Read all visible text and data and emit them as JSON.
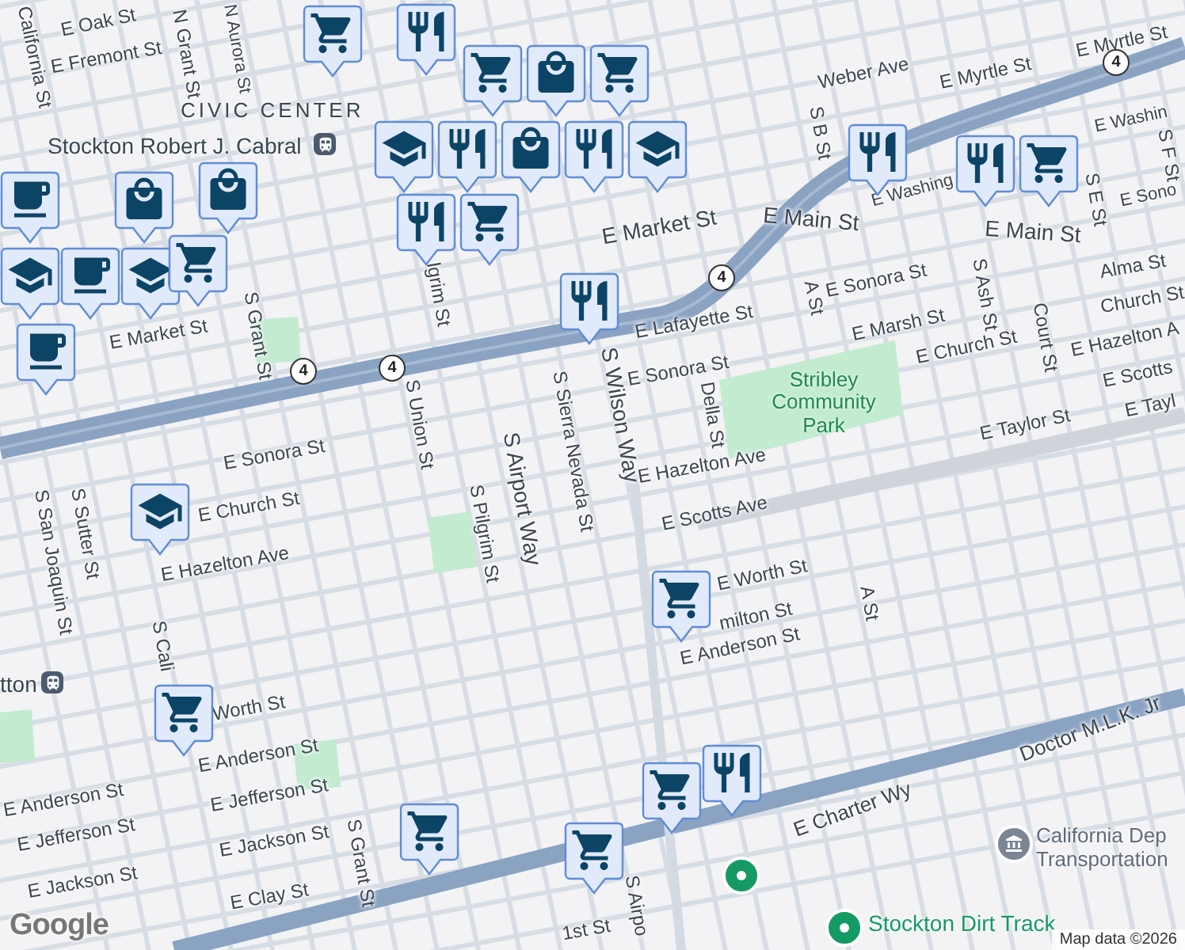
{
  "map": {
    "district_label": "CIVIC CENTER",
    "streets": [
      {
        "name": "E Oak St"
      },
      {
        "name": "E Fremont St"
      },
      {
        "name": "California St"
      },
      {
        "name": "N Grant St"
      },
      {
        "name": "N Aurora St"
      },
      {
        "name": "E Market St"
      },
      {
        "name": "S Grant St"
      },
      {
        "name": "lgrim St"
      },
      {
        "name": "S Union St"
      },
      {
        "name": "S Airport Way"
      },
      {
        "name": "S Sierra Nevada St"
      },
      {
        "name": "S Wilson Way"
      },
      {
        "name": "E Sonora St"
      },
      {
        "name": "E Market St"
      },
      {
        "name": "E Main St"
      },
      {
        "name": "E Main St"
      },
      {
        "name": "Weber Ave"
      },
      {
        "name": "E Myrtle St"
      },
      {
        "name": "E Myrtle St"
      },
      {
        "name": "S B St"
      },
      {
        "name": "E Washing"
      },
      {
        "name": "E Washin"
      },
      {
        "name": "E Lafayette St"
      },
      {
        "name": "E Sonora St"
      },
      {
        "name": "A St"
      },
      {
        "name": "E Marsh St"
      },
      {
        "name": "E Church St"
      },
      {
        "name": "S Ash St"
      },
      {
        "name": "Court St"
      },
      {
        "name": "Alma St"
      },
      {
        "name": "Church St"
      },
      {
        "name": "E Hazelton A"
      },
      {
        "name": "E Scotts"
      },
      {
        "name": "E Tayl"
      },
      {
        "name": "E Taylor St"
      },
      {
        "name": "E Sonora St"
      },
      {
        "name": "Della St"
      },
      {
        "name": "E Hazelton Ave"
      },
      {
        "name": "E Scotts Ave"
      },
      {
        "name": "E Worth St"
      },
      {
        "name": "milton St"
      },
      {
        "name": "E Anderson St"
      },
      {
        "name": "A St"
      },
      {
        "name": "E Charter Wy"
      },
      {
        "name": "Doctor M.L.K. Jr"
      },
      {
        "name": "S Sutter St"
      },
      {
        "name": "S San Joaquin St"
      },
      {
        "name": "E Church St"
      },
      {
        "name": "E Hazelton Ave"
      },
      {
        "name": "S Cali"
      },
      {
        "name": "Worth St"
      },
      {
        "name": "E Anderson St"
      },
      {
        "name": "E Anderson St"
      },
      {
        "name": "E Jefferson St"
      },
      {
        "name": "E Jefferson St"
      },
      {
        "name": "E Jackson St"
      },
      {
        "name": "E Jackson St"
      },
      {
        "name": "E Clay St"
      },
      {
        "name": "S Grant St"
      },
      {
        "name": "S Pilgrim St"
      },
      {
        "name": "1st St"
      },
      {
        "name": "S Airpo"
      },
      {
        "name": "S F St"
      },
      {
        "name": "S E St"
      },
      {
        "name": "E Sono"
      }
    ],
    "parks": [
      {
        "name": "Stribley Community Park"
      }
    ],
    "places": [
      {
        "name": "Stockton Robert J. Cabral",
        "kind": "transit"
      },
      {
        "name": "tton",
        "kind": "transit"
      },
      {
        "name": "California Dep\nTransportation",
        "kind": "government"
      },
      {
        "name": "Stockton Dirt Track",
        "kind": "venue"
      },
      {
        "kind": "pin"
      }
    ],
    "route_shields": [
      "4",
      "4",
      "4",
      "4"
    ],
    "markers": [
      {
        "kind": "cart"
      },
      {
        "kind": "food"
      },
      {
        "kind": "cart"
      },
      {
        "kind": "bag"
      },
      {
        "kind": "cart"
      },
      {
        "kind": "grad"
      },
      {
        "kind": "food"
      },
      {
        "kind": "bag"
      },
      {
        "kind": "food"
      },
      {
        "kind": "grad"
      },
      {
        "kind": "food"
      },
      {
        "kind": "cart"
      },
      {
        "kind": "food"
      },
      {
        "kind": "food"
      },
      {
        "kind": "food"
      },
      {
        "kind": "cart"
      },
      {
        "kind": "cup"
      },
      {
        "kind": "bag"
      },
      {
        "kind": "bag"
      },
      {
        "kind": "grad"
      },
      {
        "kind": "cup"
      },
      {
        "kind": "grad"
      },
      {
        "kind": "cart"
      },
      {
        "kind": "cup"
      },
      {
        "kind": "grad"
      },
      {
        "kind": "cart"
      },
      {
        "kind": "cart"
      },
      {
        "kind": "cart"
      },
      {
        "kind": "cart"
      },
      {
        "kind": "cart"
      },
      {
        "kind": "food"
      }
    ],
    "attribution": "Map data ©2026",
    "logo": "Google"
  }
}
